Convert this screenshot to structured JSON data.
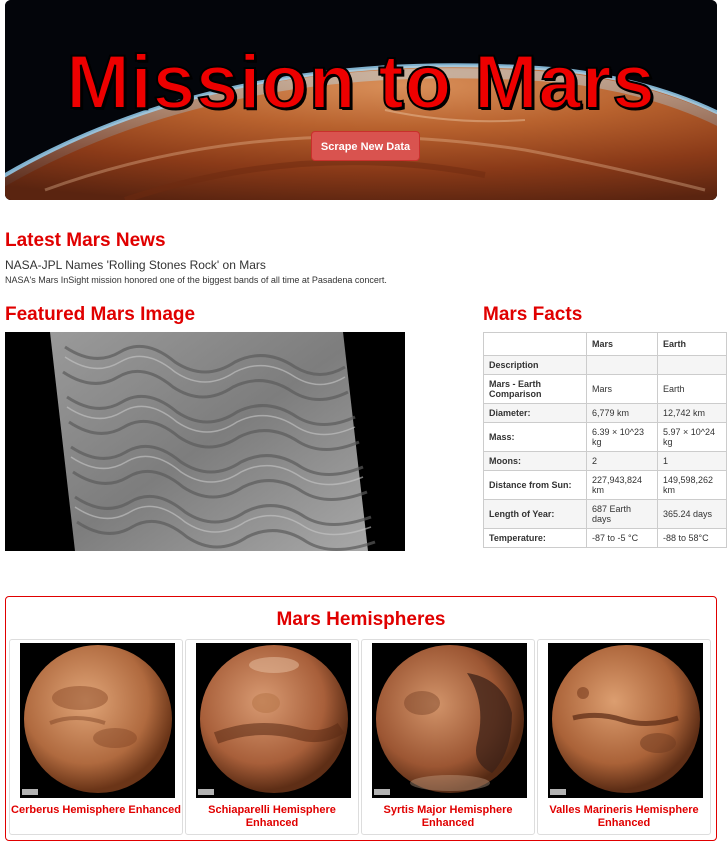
{
  "hero": {
    "title": "Mission to Mars",
    "scrape_button": "Scrape New Data"
  },
  "news": {
    "heading": "Latest Mars News",
    "headline": "NASA-JPL Names 'Rolling Stones Rock' on Mars",
    "teaser": "NASA's Mars InSight mission honored one of the biggest bands of all time at Pasadena concert."
  },
  "featured": {
    "heading": "Featured Mars Image"
  },
  "facts": {
    "heading": "Mars Facts",
    "columns": [
      "",
      "Mars",
      "Earth"
    ],
    "rows": [
      {
        "label": "Description",
        "mars": "",
        "earth": ""
      },
      {
        "label": "Mars - Earth Comparison",
        "mars": "Mars",
        "earth": "Earth"
      },
      {
        "label": "Diameter:",
        "mars": "6,779 km",
        "earth": "12,742 km"
      },
      {
        "label": "Mass:",
        "mars": "6.39 × 10^23 kg",
        "earth": "5.97 × 10^24 kg"
      },
      {
        "label": "Moons:",
        "mars": "2",
        "earth": "1"
      },
      {
        "label": "Distance from Sun:",
        "mars": "227,943,824 km",
        "earth": "149,598,262 km"
      },
      {
        "label": "Length of Year:",
        "mars": "687 Earth days",
        "earth": "365.24 days"
      },
      {
        "label": "Temperature:",
        "mars": "-87 to -5 °C",
        "earth": "-88 to 58°C"
      }
    ]
  },
  "hemispheres": {
    "heading": "Mars Hemispheres",
    "items": [
      {
        "caption": "Cerberus Hemisphere Enhanced"
      },
      {
        "caption": "Schiaparelli Hemisphere Enhanced"
      },
      {
        "caption": "Syrtis Major Hemisphere Enhanced"
      },
      {
        "caption": "Valles Marineris Hemisphere Enhanced"
      }
    ]
  },
  "colors": {
    "accent_red": "#e00000",
    "button_red": "#d9534f"
  }
}
